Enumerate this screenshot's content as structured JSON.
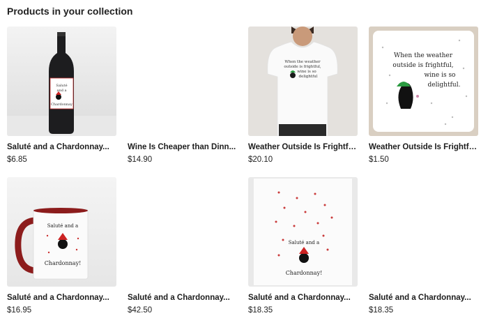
{
  "heading": "Products in your collection",
  "products": [
    {
      "name": "Saluté and a Chardonnay...",
      "price": "$6.85",
      "image": "wine-bottle-label",
      "label_lines": [
        "Saluté",
        "and a",
        "Chardonnay"
      ]
    },
    {
      "name": "Wine Is Cheaper than Dinn...",
      "price": "$14.90",
      "image": "blank"
    },
    {
      "name": "Weather Outside Is Frightfu...",
      "price": "$20.10",
      "image": "white-t-shirt",
      "shirt_lines": [
        "When the weather",
        "outside is frightful,",
        "wine is so",
        "delightful"
      ]
    },
    {
      "name": "Weather Outside Is Frightfu...",
      "price": "$1.50",
      "image": "coaster",
      "coaster_lines": [
        "When the weather",
        "outside is frightful,",
        "wine is so",
        "delightful."
      ]
    },
    {
      "name": "Saluté and a Chardonnay...",
      "price": "$16.95",
      "image": "red-handled-mug",
      "mug_lines": [
        "Saluté and a",
        "Chardonnay!"
      ]
    },
    {
      "name": "Saluté and a Chardonnay...",
      "price": "$42.50",
      "image": "blank"
    },
    {
      "name": "Saluté and a Chardonnay...",
      "price": "$18.35",
      "image": "kitchen-towel",
      "towel_lines": [
        "Saluté and a",
        "Chardonnay!"
      ]
    },
    {
      "name": "Saluté and a Chardonnay...",
      "price": "$18.35",
      "image": "blank"
    }
  ]
}
